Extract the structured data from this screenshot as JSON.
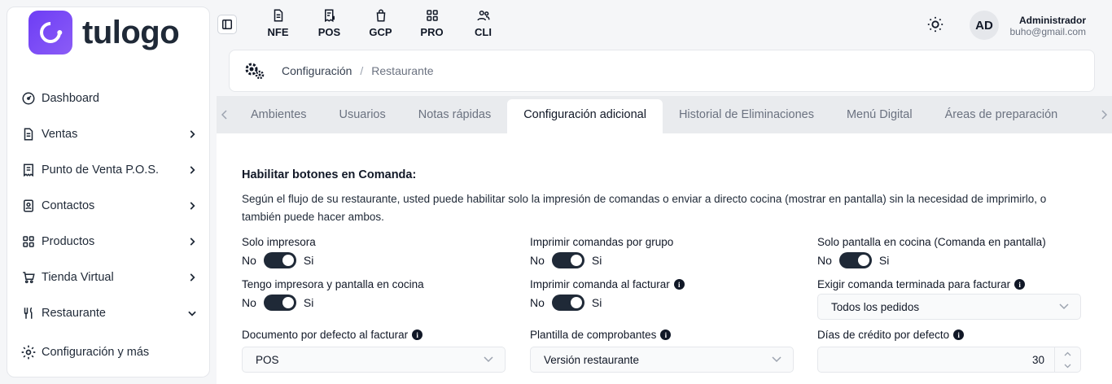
{
  "brand": {
    "name": "tulogo",
    "accent": "#7c4dff"
  },
  "sidebar": {
    "items": [
      {
        "label": "Dashboard",
        "icon": "gauge-icon",
        "has_chevron": false,
        "expanded": false
      },
      {
        "label": "Ventas",
        "icon": "document-icon",
        "has_chevron": true,
        "expanded": false
      },
      {
        "label": "Punto de Venta P.O.S.",
        "icon": "receipt-icon",
        "has_chevron": true,
        "expanded": false
      },
      {
        "label": "Contactos",
        "icon": "contacts-icon",
        "has_chevron": true,
        "expanded": false
      },
      {
        "label": "Productos",
        "icon": "grid-icon",
        "has_chevron": true,
        "expanded": false
      },
      {
        "label": "Tienda Virtual",
        "icon": "cart-icon",
        "has_chevron": true,
        "expanded": false
      },
      {
        "label": "Restaurante",
        "icon": "utensils-icon",
        "has_chevron": true,
        "expanded": true
      }
    ],
    "config": {
      "label": "Configuración y más",
      "icon": "gear-icon"
    }
  },
  "topnav": [
    {
      "label": "NFE",
      "icon": "file-icon"
    },
    {
      "label": "POS",
      "icon": "receipt-dollar-icon"
    },
    {
      "label": "GCP",
      "icon": "bag-icon"
    },
    {
      "label": "PRO",
      "icon": "grid-icon"
    },
    {
      "label": "CLI",
      "icon": "users-icon"
    }
  ],
  "user": {
    "initials": "AD",
    "name": "Administrador",
    "email": "buho@gmail.com"
  },
  "breadcrumb": {
    "first": "Configuración",
    "separator": "/",
    "current": "Restaurante"
  },
  "tabs": [
    {
      "label": "Ambientes",
      "active": false
    },
    {
      "label": "Usuarios",
      "active": false
    },
    {
      "label": "Notas rápidas",
      "active": false
    },
    {
      "label": "Configuración adicional",
      "active": true
    },
    {
      "label": "Historial de Eliminaciones",
      "active": false
    },
    {
      "label": "Menú Digital",
      "active": false
    },
    {
      "label": "Áreas de preparación",
      "active": false
    }
  ],
  "section": {
    "title": "Habilitar botones en Comanda:",
    "description": "Según el flujo de su restaurante, usted puede habilitar solo la impresión de comandas o enviar a directo cocina (mostrar en pantalla) sin la necesidad de imprimirlo, o también puede hacer ambos."
  },
  "switch_labels": {
    "off": "No",
    "on": "Si"
  },
  "toggles": [
    {
      "label": "Solo impresora",
      "value": true,
      "info": false
    },
    {
      "label": "Imprimir comandas por grupo",
      "value": true,
      "info": false
    },
    {
      "label": "Solo pantalla en cocina (Comanda en pantalla)",
      "value": true,
      "info": false
    },
    {
      "label": "Tengo impresora y pantalla en cocina",
      "value": true,
      "info": false
    },
    {
      "label": "Imprimir comanda al facturar",
      "value": true,
      "info": true
    }
  ],
  "exigir": {
    "label": "Exigir comanda terminada para facturar",
    "value": "Todos los pedidos"
  },
  "documento": {
    "label": "Documento por defecto al facturar",
    "value": "POS"
  },
  "plantilla": {
    "label": "Plantilla de comprobantes",
    "value": "Versión restaurante"
  },
  "dias": {
    "label": "Días de crédito por defecto",
    "value": "30"
  }
}
